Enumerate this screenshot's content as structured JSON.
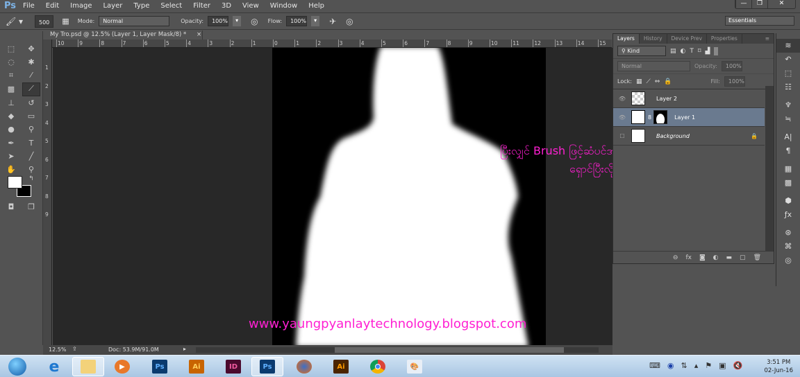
{
  "app": {
    "logo": "Ps"
  },
  "menu": [
    "File",
    "Edit",
    "Image",
    "Layer",
    "Type",
    "Select",
    "Filter",
    "3D",
    "View",
    "Window",
    "Help"
  ],
  "window_controls": [
    "—",
    "❐",
    "✕"
  ],
  "options": {
    "brush_size": "500",
    "mode_label": "Mode:",
    "mode_value": "Normal",
    "opacity_label": "Opacity:",
    "opacity_value": "100%",
    "flow_label": "Flow:",
    "flow_value": "100%",
    "workspace": "Essentials"
  },
  "document": {
    "tab_title": "My Tro.psd @ 12.5% (Layer 1, Layer Mask/8) *",
    "close": "×",
    "zoom": "12.5%",
    "doc_info": "Doc: 53.9M/91.0M"
  },
  "rulers": {
    "top": [
      "10",
      "9",
      "8",
      "7",
      "6",
      "5",
      "4",
      "3",
      "2",
      "1",
      "0",
      "1",
      "2",
      "3",
      "4",
      "5",
      "6",
      "7",
      "8",
      "9",
      "10",
      "11",
      "12",
      "13",
      "14",
      "15"
    ],
    "left": [
      "1",
      "2",
      "3",
      "4",
      "5",
      "6",
      "7",
      "8",
      "9"
    ]
  },
  "layers_panel": {
    "tabs": [
      "Layers",
      "History",
      "Device Prev",
      "Properties"
    ],
    "filter_kind": "Kind",
    "blend_mode": "Normal",
    "opacity_label": "Opacity:",
    "opacity_value": "100%",
    "lock_label": "Lock:",
    "fill_label": "Fill:",
    "fill_value": "100%",
    "layers": [
      {
        "name": "Layer 2",
        "visible": true,
        "selected": false
      },
      {
        "name": "Layer 1",
        "visible": true,
        "selected": true
      },
      {
        "name": "Background",
        "visible": false,
        "selected": false,
        "locked": true
      }
    ],
    "footer_icons": [
      "link-icon",
      "fx-icon",
      "mask-icon",
      "adjustment-icon",
      "folder-icon",
      "new-layer-icon",
      "trash-icon"
    ],
    "footer_labels": [
      "⊖",
      "fx",
      "◙",
      "◐",
      "▬",
      "▢",
      "🗑"
    ]
  },
  "overlay": {
    "line1": "ပြီးလျှင် Brush ဖြင့်ဆံပင်အနားနေရာတွေ",
    "line2": "ရှောင်ပြီးလိုက်ပွတ်ပါ",
    "url": "www.yaungpyanlaytechnology.blogspot.com",
    "color": "#ff1fd2"
  },
  "taskbar": {
    "apps": [
      "start",
      "internet-explorer",
      "file-explorer",
      "media-player",
      "photoshop",
      "illustrator",
      "indesign",
      "photoshop-active",
      "firefox",
      "illustrator",
      "chrome",
      "paint"
    ],
    "labels": {
      "ps": "Ps",
      "ai": "Ai",
      "id": "ID"
    },
    "time": "3:51 PM",
    "date": "02-Jun-16"
  }
}
